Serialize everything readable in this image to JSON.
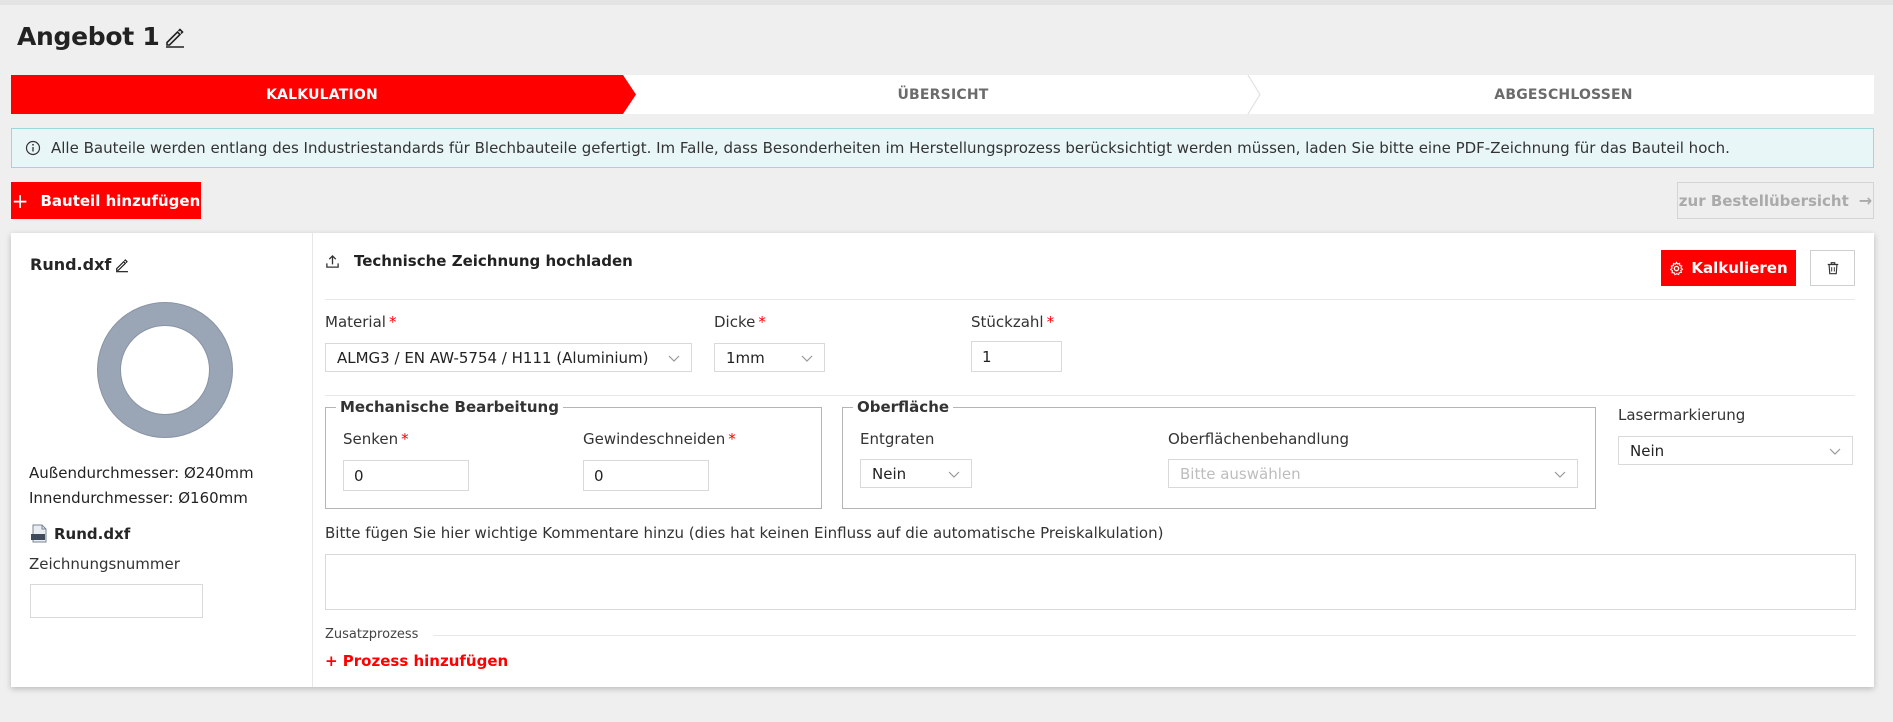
{
  "header": {
    "title": "Angebot 1"
  },
  "steps": [
    {
      "label": "KALKULATION",
      "active": true
    },
    {
      "label": "ÜBERSICHT",
      "active": false
    },
    {
      "label": "ABGESCHLOSSEN",
      "active": false
    }
  ],
  "info": {
    "text": "Alle Bauteile werden entlang des Industriestandards für Blechbauteile gefertigt. Im Falle, dass Besonderheiten im Herstellungsprozess berücksichtigt werden müssen, laden Sie bitte eine PDF-Zeichnung für das Bauteil hoch."
  },
  "toolbar": {
    "add_label": "Bauteil hinzufügen",
    "order_label": "zur Bestellübersicht"
  },
  "part": {
    "name": "Rund.dxf",
    "outer": "Außendurchmesser: Ø240mm",
    "inner": "Innendurchmesser: Ø160mm",
    "file_name": "Rund.dxf",
    "drawing_label": "Zeichnungsnummer",
    "drawing_value": "",
    "upload_label": "Technische Zeichnung hochladen",
    "calc_label": "Kalkulieren",
    "material_label": "Material",
    "material_value": "ALMG3 / EN AW-5754 / H111 (Aluminium)",
    "thickness_label": "Dicke",
    "thickness_value": "1mm",
    "qty_label": "Stückzahl",
    "qty_value": "1",
    "mech_legend": "Mechanische Bearbeitung",
    "sink_label": "Senken",
    "sink_value": "0",
    "thread_label": "Gewindeschneiden",
    "thread_value": "0",
    "surface_legend": "Oberfläche",
    "deburr_label": "Entgraten",
    "deburr_value": "Nein",
    "treatment_label": "Oberflächenbehandlung",
    "treatment_placeholder": "Bitte auswählen",
    "laser_label": "Lasermarkierung",
    "laser_value": "Nein",
    "comment_label": "Bitte fügen Sie hier wichtige Kommentare hinzu (dies hat keinen Einfluss auf die automatische Preiskalkulation)",
    "comment_value": "",
    "extra_label": "Zusatzprozess",
    "add_process_label": "+ Prozess hinzufügen"
  },
  "colors": {
    "accent": "#ff0000",
    "info_bg": "#e8f6f8",
    "info_border": "#9cd6de",
    "ring": "#9aa6b6"
  },
  "icons": [
    "edit-icon",
    "info-icon",
    "plus-icon",
    "arrow-right-icon",
    "upload-icon",
    "gear-icon",
    "trash-icon",
    "chevron-down-icon",
    "dxf-file-icon"
  ]
}
